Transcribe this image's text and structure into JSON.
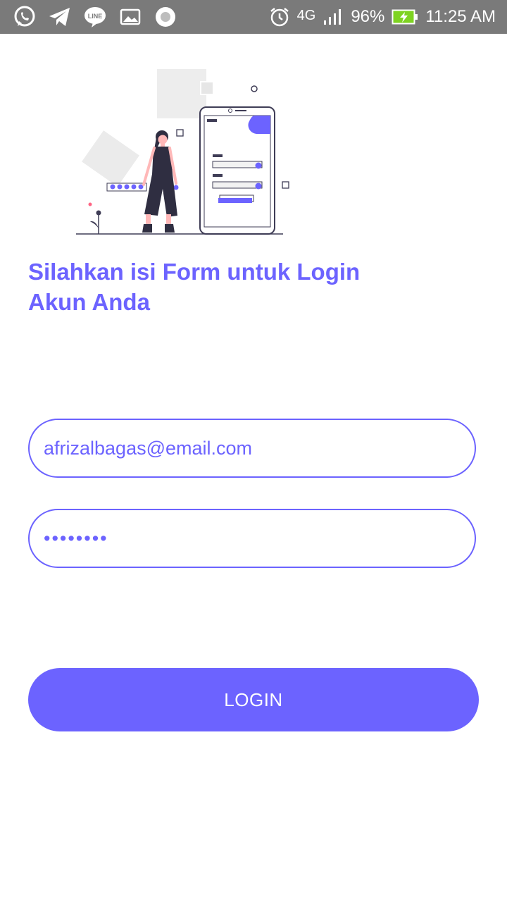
{
  "status_bar": {
    "left_icons": [
      "whatsapp-icon",
      "telegram-icon",
      "line-icon",
      "gallery-icon",
      "record-icon"
    ],
    "alarm_icon": "alarm-clock-icon",
    "network": "4G",
    "signal_icon": "signal-bars-icon",
    "battery_percent": "96%",
    "battery_icon": "battery-charging-icon",
    "time": "11:25 AM"
  },
  "illustration": {
    "icon": "login-illustration"
  },
  "login": {
    "title_line1": "Silahkan isi Form untuk Login",
    "title_line2": "Akun Anda",
    "email_value": "afrizalbagas@email.com",
    "password_value": "••••••••",
    "button_label": "LOGIN"
  },
  "colors": {
    "accent": "#6c63ff",
    "status_bar": "#7a7a7a",
    "battery_green": "#7ed321",
    "background": "#ffffff"
  }
}
